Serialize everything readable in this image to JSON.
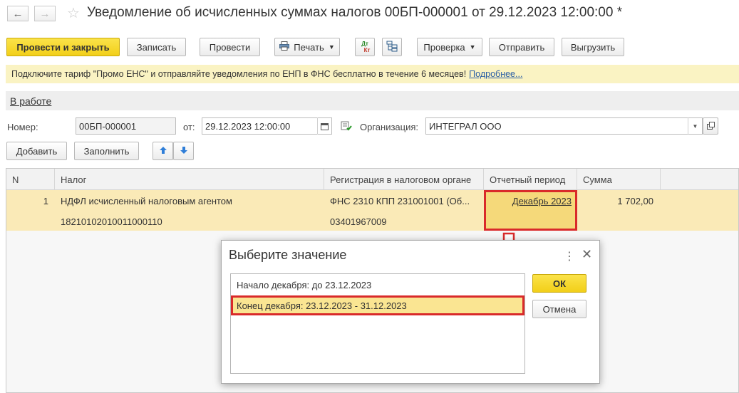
{
  "window": {
    "title": "Уведомление об исчисленных суммах налогов 00БП-000001 от 29.12.2023 12:00:00 *"
  },
  "toolbar": {
    "post_close": "Провести и закрыть",
    "save": "Записать",
    "post": "Провести",
    "print": "Печать",
    "dtkt_top": "Дт",
    "dtkt_bottom": "Кт",
    "check": "Проверка",
    "send": "Отправить",
    "export": "Выгрузить"
  },
  "banner": {
    "text": "Подключите тариф \"Промо ЕНС\" и отправляйте уведомления по ЕНП в ФНС бесплатно в течение 6 месяцев!",
    "link": "Подробнее..."
  },
  "status": "В работе",
  "form": {
    "number_label": "Номер:",
    "number_value": "00БП-000001",
    "date_label": "от:",
    "date_value": "29.12.2023 12:00:00",
    "org_label": "Организация:",
    "org_value": "ИНТЕГРАЛ ООО"
  },
  "table_toolbar": {
    "add": "Добавить",
    "fill": "Заполнить"
  },
  "table": {
    "columns": [
      "N",
      "Налог",
      "Регистрация в налоговом органе",
      "Отчетный период",
      "Сумма"
    ],
    "rows": [
      {
        "n": "1",
        "tax": "НДФЛ исчисленный налоговым агентом",
        "kbk": "18210102010011000110",
        "registration": "ФНС 2310 КПП 231001001 (Об...",
        "oktmo": "03401967009",
        "period": "Декабрь 2023",
        "sum": "1 702,00"
      }
    ]
  },
  "dialog": {
    "title": "Выберите значение",
    "items": [
      "Начало декабря: до 23.12.2023",
      "Конец декабря: 23.12.2023 - 31.12.2023"
    ],
    "selected_index": 1,
    "ok": "ОК",
    "cancel": "Отмена"
  },
  "colors": {
    "primary_button": "#f2cf19",
    "highlight_border": "#d92a2a",
    "row_selected": "#faeab7",
    "banner": "#faf3c3"
  }
}
